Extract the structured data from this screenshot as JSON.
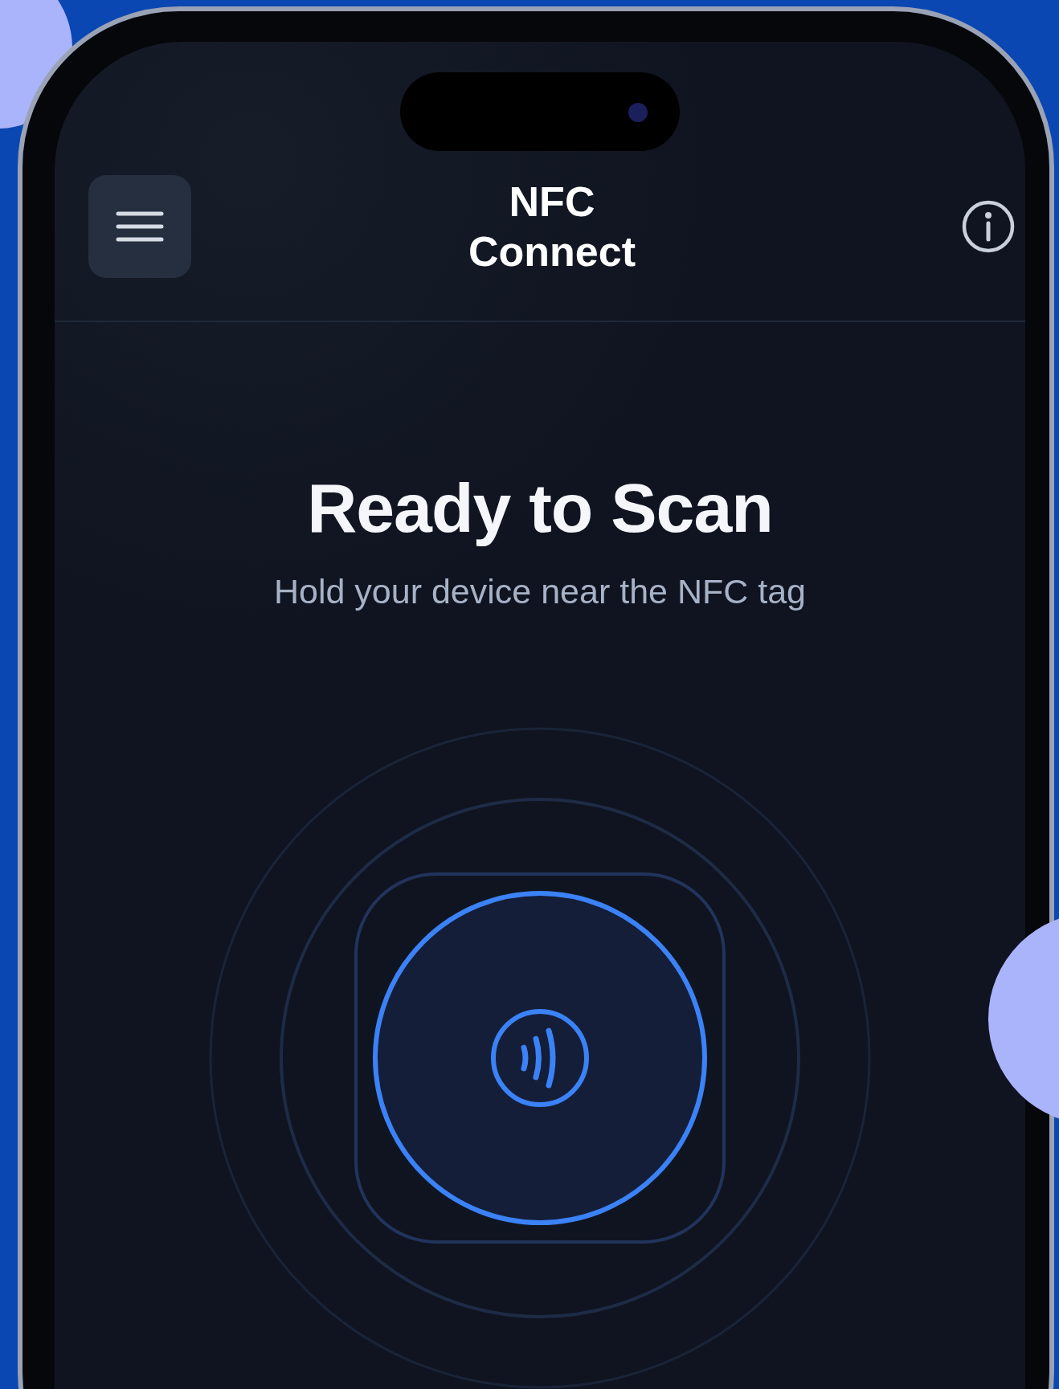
{
  "app": {
    "title": "NFC Connect"
  },
  "scan": {
    "heading": "Ready to Scan",
    "subtitle": "Hold your device near the NFC tag"
  }
}
